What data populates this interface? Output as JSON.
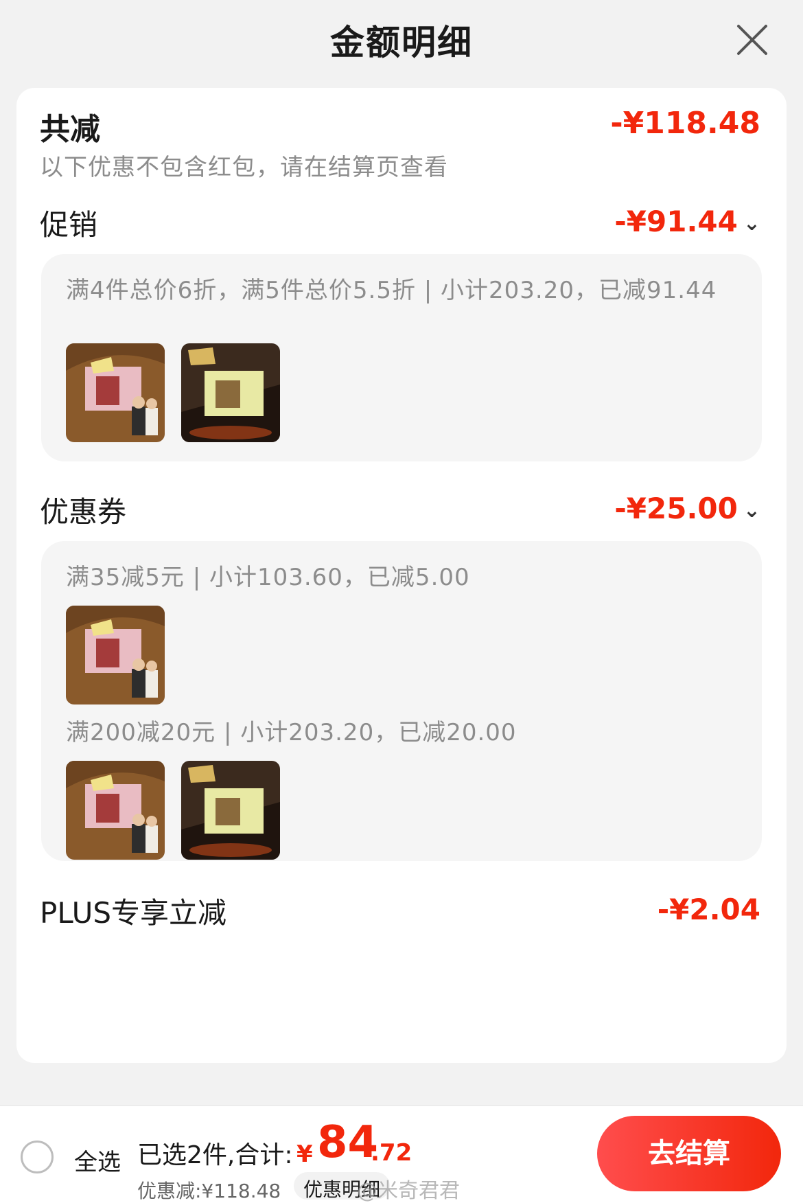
{
  "header": {
    "title": "金额明细"
  },
  "summary": {
    "total_label": "共减",
    "total_amount": "-¥118.48",
    "note": "以下优惠不包含红包，请在结算页查看"
  },
  "promotion": {
    "label": "促销",
    "amount": "-¥91.44",
    "chevron": "›",
    "rule": "满4件总价6折，满5件总价5.5折 | 小计203.20，已减91.44"
  },
  "coupons": {
    "label": "优惠券",
    "amount": "-¥25.00",
    "chevron": "›",
    "groups": [
      {
        "rule": "满35减5元 | 小计103.60，已减5.00"
      },
      {
        "rule": "满200减20元 | 小计203.20，已减20.00"
      }
    ]
  },
  "plus": {
    "label": "PLUS专享立减",
    "amount": "-¥2.04"
  },
  "bottom_bar": {
    "select_all": "全选",
    "selected_text": "已选2件,合计:",
    "currency": "¥",
    "total_int": "84",
    "total_dec": ".72",
    "discount_line": "优惠减:¥118.48",
    "detail_link": "优惠明细",
    "watermark": "@米奇君君",
    "checkout": "去结算"
  },
  "colors": {
    "accent": "#f2270c",
    "muted": "#8c8c8c",
    "box_bg": "#f5f5f5"
  },
  "icons": {
    "close": "close-icon",
    "chevron": "chevron-down-icon",
    "radio": "radio-unchecked-icon"
  }
}
